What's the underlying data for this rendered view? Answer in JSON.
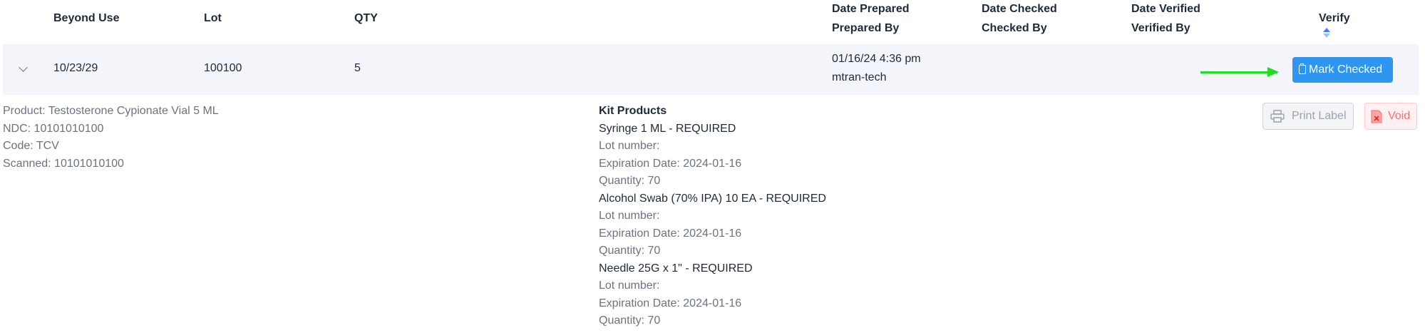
{
  "header": {
    "beyond_use": "Beyond Use",
    "lot": "Lot",
    "qty": "QTY",
    "date_prepared": "Date Prepared",
    "prepared_by": "Prepared By",
    "date_checked": "Date Checked",
    "checked_by": "Checked By",
    "date_verified": "Date Verified",
    "verified_by": "Verified By",
    "verify": "Verify",
    "verify_sort_icon": "sort-icon"
  },
  "row": {
    "expand_icon": "chevron-down-icon",
    "beyond_use": "10/23/29",
    "lot": "100100",
    "qty": "5",
    "date_prepared": "01/16/24 4:36 pm",
    "prepared_by": "mtran-tech",
    "mark_checked_label": "Mark Checked",
    "mark_checked_icon": "clipboard-check-icon"
  },
  "details": {
    "product": "Product: Testosterone Cypionate Vial 5 ML",
    "ndc": "NDC: 10101010100",
    "code": "Code: TCV",
    "scanned": "Scanned: 10101010100"
  },
  "kit": {
    "title": "Kit Products",
    "items": [
      {
        "name": "Syringe 1 ML - REQUIRED",
        "lot": "Lot number:",
        "expiration": "Expiration Date: 2024-01-16",
        "quantity": "Quantity: 70"
      },
      {
        "name": "Alcohol Swab (70% IPA) 10 EA - REQUIRED",
        "lot": "Lot number:",
        "expiration": "Expiration Date: 2024-01-16",
        "quantity": "Quantity: 70"
      },
      {
        "name": "Needle 25G x 1\" - REQUIRED",
        "lot": "Lot number:",
        "expiration": "Expiration Date: 2024-01-16",
        "quantity": "Quantity: 70"
      }
    ]
  },
  "actions": {
    "print_label": "Print Label",
    "print_icon": "printer-icon",
    "void": "Void",
    "void_icon": "void-file-icon"
  },
  "annotation": {
    "arrow_color": "#22dd22"
  },
  "colors": {
    "primary": "#2e96ee",
    "row_bg": "#f4f5fb",
    "void": "#f87171"
  }
}
